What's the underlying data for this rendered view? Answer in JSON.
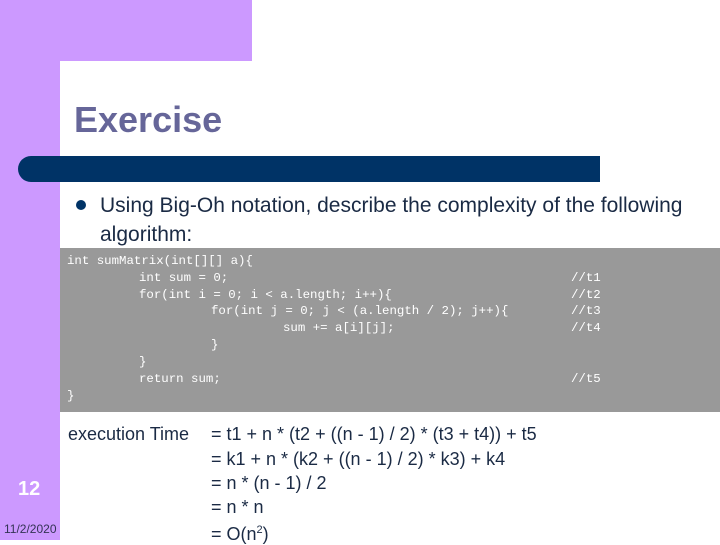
{
  "slide": {
    "title": "Exercise",
    "bullet": "Using Big-Oh notation, describe the complexity of the following algorithm:",
    "slide_number": "12",
    "date": "11/2/2020",
    "colors": {
      "accent_purple": "#cc99ff",
      "title_color": "#666699",
      "rule_navy": "#003366",
      "code_bg": "#999999"
    }
  },
  "code": {
    "lines": [
      "int sumMatrix(int[][] a){",
      "int sum = 0;",
      "for(int i = 0; i < a.length; i++){",
      "for(int j = 0; j < (a.length / 2); j++){",
      "sum += a[i][j];",
      "}",
      "}",
      "return sum;",
      "}"
    ],
    "comments": [
      "//t1",
      "//t2",
      "//t3",
      "//t4",
      "//t5"
    ]
  },
  "analysis": {
    "label": "execution Time",
    "lines": [
      "= t1 + n * (t2 + ((n - 1) / 2) * (t3 + t4)) + t5",
      "= k1 + n * (k2 + ((n - 1) / 2) * k3) + k4",
      "= n * (n - 1) / 2",
      "= n * n"
    ],
    "final_prefix": "= O(n",
    "final_exponent": "2",
    "final_suffix": ")"
  }
}
